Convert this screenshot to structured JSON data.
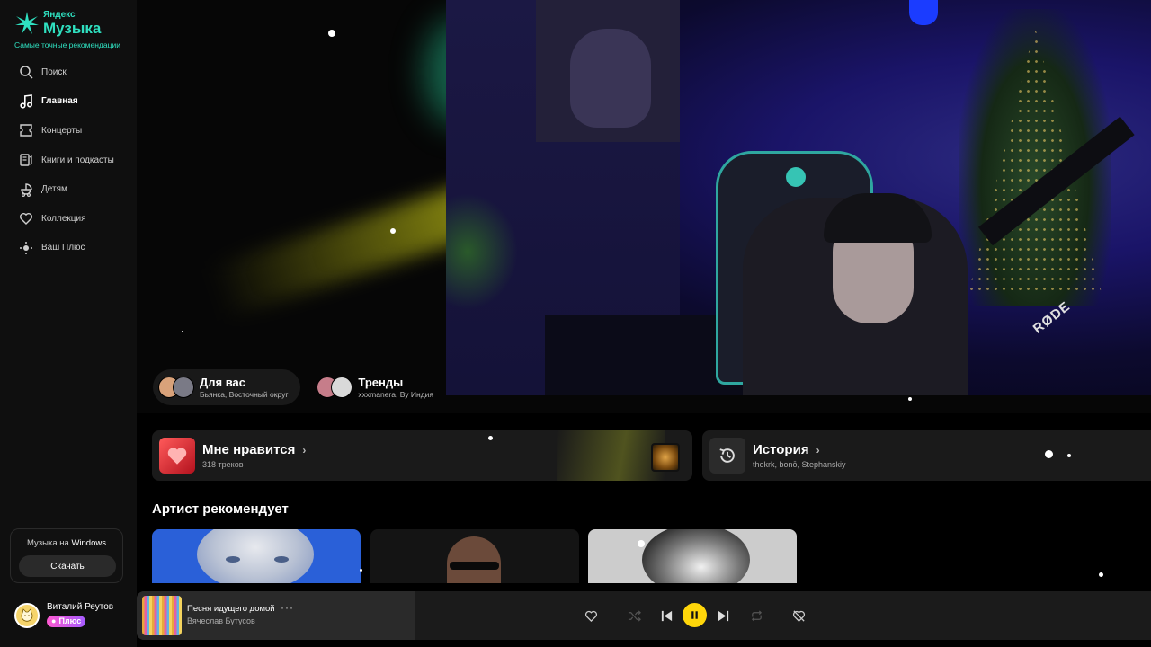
{
  "brand": {
    "name_top": "Яндекс",
    "name_main": "Музыка",
    "tagline": "Самые точные рекомендации",
    "accent_color": "#2fe0c0"
  },
  "sidebar": {
    "items": [
      {
        "label": "Поиск",
        "icon": "search-icon"
      },
      {
        "label": "Главная",
        "icon": "music-note-icon",
        "active": true
      },
      {
        "label": "Концерты",
        "icon": "ticket-icon"
      },
      {
        "label": "Книги и подкасты",
        "icon": "book-icon"
      },
      {
        "label": "Детям",
        "icon": "stroller-icon"
      },
      {
        "label": "Коллекция",
        "icon": "heart-icon"
      },
      {
        "label": "Ваш Плюс",
        "icon": "plus-dots-icon"
      }
    ]
  },
  "promo": {
    "text_prefix": "Музыка на",
    "text_platform": "Windows",
    "button_label": "Скачать"
  },
  "user": {
    "name": "Виталий Реутов",
    "badge": "Плюс"
  },
  "hero": {
    "chips": [
      {
        "title": "Для вас",
        "subtitle": "Бьянка, Восточный округ"
      },
      {
        "title": "Тренды",
        "subtitle": "xxxmanera, Ву Индия"
      }
    ],
    "stream_text": "RØDE"
  },
  "cards": {
    "likes": {
      "title": "Мне нравится",
      "subtitle": "318 треков"
    },
    "history": {
      "title": "История",
      "subtitle": "thekrk, bonō, Stephanskiy"
    }
  },
  "artist_section": {
    "title": "Артист рекомендует"
  },
  "player": {
    "track_title": "Песня идущего домой",
    "track_artist": "Вячеслав Бутусов",
    "more_label": "···",
    "play_button_color": "#ffd60a"
  }
}
